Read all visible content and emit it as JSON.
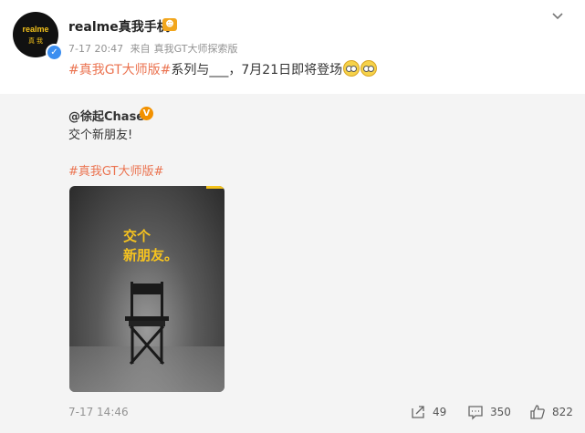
{
  "post": {
    "username": "realme真我手机",
    "avatar_brand": "realme",
    "avatar_brand_sub": "真 我",
    "time": "7-17 20:47",
    "source_prefix": "来自",
    "source": "真我GT大师探索版",
    "hashtag": "#真我GT大师版#",
    "text_rest": "系列与___，7月21日即将登场"
  },
  "repost": {
    "author": "@徐起Chase",
    "text": "交个新朋友!",
    "hashtag": "#真我GT大师版#",
    "poster_line1": "交个",
    "poster_line2": "新朋友。",
    "time": "7-17 14:46",
    "share_count": "49",
    "comment_count": "350",
    "like_count": "822"
  },
  "icons": [
    "verified-icon",
    "chevron-down-icon",
    "share-icon",
    "comment-icon",
    "like-icon"
  ]
}
